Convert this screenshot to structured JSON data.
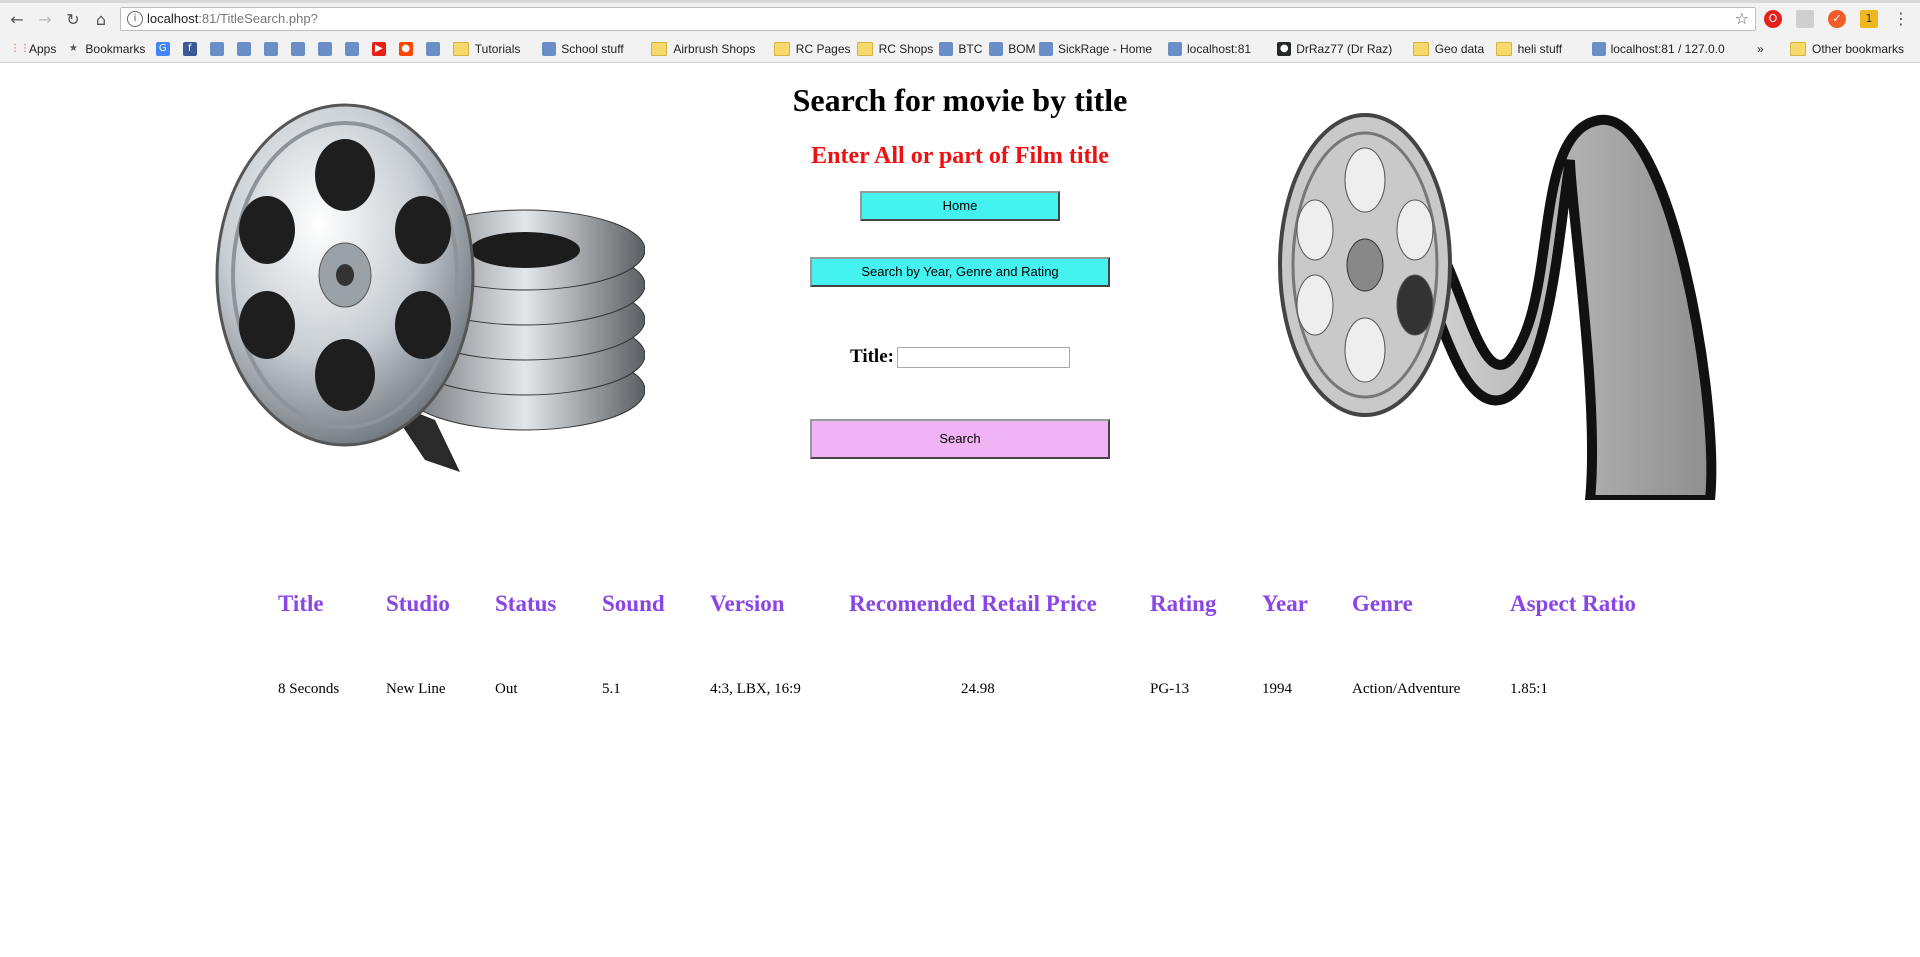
{
  "browser": {
    "url_host": "localhost",
    "url_rest": ":81/TitleSearch.php?",
    "bookmarks": [
      {
        "label": "Apps",
        "kind": "apps"
      },
      {
        "label": "Bookmarks",
        "kind": "star"
      },
      {
        "label": "",
        "kind": "google"
      },
      {
        "label": "",
        "kind": "facebook"
      },
      {
        "label": "",
        "kind": "site"
      },
      {
        "label": "",
        "kind": "site"
      },
      {
        "label": "",
        "kind": "site"
      },
      {
        "label": "",
        "kind": "site"
      },
      {
        "label": "",
        "kind": "site"
      },
      {
        "label": "",
        "kind": "site"
      },
      {
        "label": "",
        "kind": "youtube"
      },
      {
        "label": "",
        "kind": "reddit"
      },
      {
        "label": "",
        "kind": "site"
      },
      {
        "label": "Tutorials",
        "kind": "folder"
      },
      {
        "label": "School stuff",
        "kind": "site"
      },
      {
        "label": "Airbrush Shops",
        "kind": "folder"
      },
      {
        "label": "RC Pages",
        "kind": "folder"
      },
      {
        "label": "RC Shops",
        "kind": "folder"
      },
      {
        "label": "BTC",
        "kind": "site"
      },
      {
        "label": "BOM",
        "kind": "site"
      },
      {
        "label": "SickRage - Home",
        "kind": "site"
      },
      {
        "label": "localhost:81",
        "kind": "site"
      },
      {
        "label": "DrRaz77 (Dr Raz)",
        "kind": "github"
      },
      {
        "label": "Geo data",
        "kind": "folder"
      },
      {
        "label": "heli stuff",
        "kind": "folder"
      },
      {
        "label": "localhost:81 / 127.0.0",
        "kind": "site"
      }
    ],
    "overflow": "»",
    "other_bookmarks": "Other bookmarks"
  },
  "page": {
    "title": "Search for movie by title",
    "subtitle": "Enter All or part of Film title",
    "home_button": "Home",
    "year_button": "Search by Year, Genre and Rating",
    "title_label": "Title:",
    "title_value": "",
    "search_button": "Search"
  },
  "results": {
    "headers": [
      "Title",
      "Studio",
      "Status",
      "Sound",
      "Version",
      "Recomended Retail Price",
      "Rating",
      "Year",
      "Genre",
      "Aspect Ratio"
    ],
    "rows": [
      [
        "8 Seconds",
        "New Line",
        "Out",
        "5.1",
        "4:3, LBX, 16:9",
        "24.98",
        "PG-13",
        "1994",
        "Action/Adventure",
        "1.85:1"
      ]
    ]
  },
  "colors": {
    "button_cyan": "#44f2ef",
    "button_pink": "#f0b3f4",
    "subtitle_red": "#ee1111",
    "header_purple": "#8a45e6"
  }
}
